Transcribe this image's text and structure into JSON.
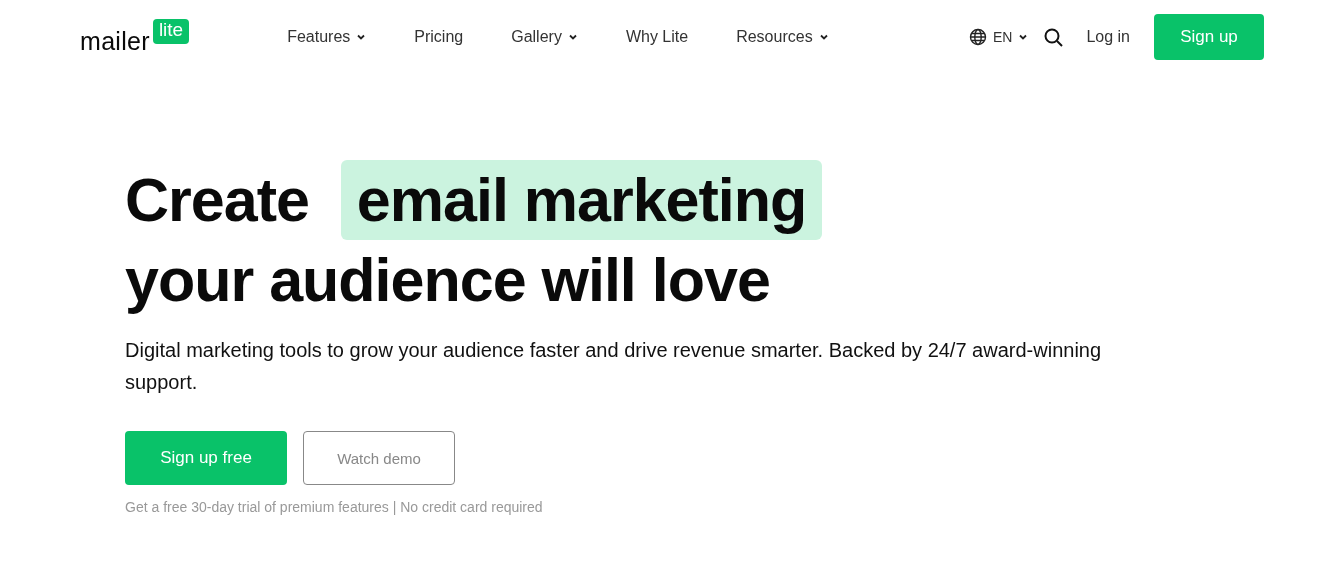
{
  "logo": {
    "word": "mailer",
    "badge": "lite"
  },
  "nav": [
    {
      "label": "Features",
      "dropdown": true
    },
    {
      "label": "Pricing",
      "dropdown": false
    },
    {
      "label": "Gallery",
      "dropdown": true
    },
    {
      "label": "Why Lite",
      "dropdown": false
    },
    {
      "label": "Resources",
      "dropdown": true
    }
  ],
  "language": {
    "label": "EN",
    "dropdown": true
  },
  "login": "Log in",
  "signup": "Sign up",
  "headline": [
    [
      {
        "text": "Create",
        "highlight": false
      },
      {
        "text": "email marketing",
        "highlight": true
      }
    ],
    [
      {
        "text": "your audience will love",
        "highlight": false
      }
    ]
  ],
  "subtitle": "Digital marketing tools to grow your audience faster and drive revenue smarter. Backed by 24/7 award-winning support.",
  "buttons": [
    {
      "label": "Sign up free",
      "kind": "primary"
    },
    {
      "label": "Watch demo",
      "kind": "outline"
    }
  ],
  "footnote": "Get a free 30-day trial of premium features | No credit card required"
}
